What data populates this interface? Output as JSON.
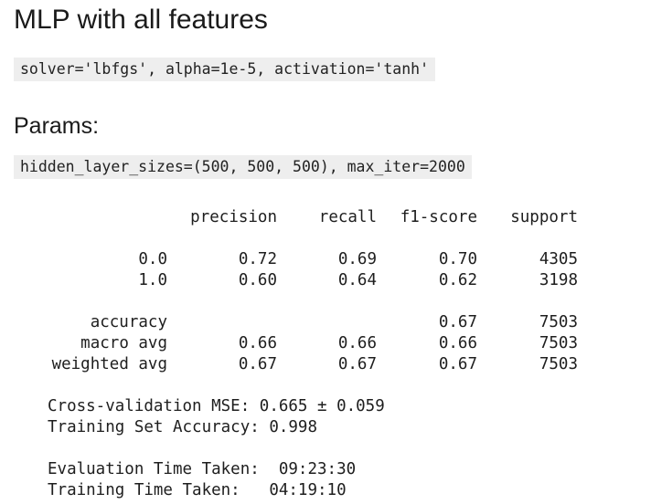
{
  "title": "MLP with all features",
  "solver_code": "solver='lbfgs', alpha=1e-5, activation='tanh'",
  "params_heading": "Params:",
  "hidden_code": "hidden_layer_sizes=(500, 500, 500), max_iter=2000",
  "report": {
    "headers": [
      "precision",
      "recall",
      "f1-score",
      "support"
    ],
    "rows": [
      {
        "label": "0.0",
        "precision": "0.72",
        "recall": "0.69",
        "f1": "0.70",
        "support": "4305"
      },
      {
        "label": "1.0",
        "precision": "0.60",
        "recall": "0.64",
        "f1": "0.62",
        "support": "3198"
      },
      {
        "label": "accuracy",
        "precision": "",
        "recall": "",
        "f1": "0.67",
        "support": "7503"
      },
      {
        "label": "macro avg",
        "precision": "0.66",
        "recall": "0.66",
        "f1": "0.66",
        "support": "7503"
      },
      {
        "label": "weighted avg",
        "precision": "0.67",
        "recall": "0.67",
        "f1": "0.67",
        "support": "7503"
      }
    ],
    "cv_line": "Cross-validation MSE: 0.665 ± 0.059",
    "train_acc_line": "Training Set Accuracy: 0.998",
    "eval_time_line": "Evaluation Time Taken:  09:23:30",
    "train_time_line": "Training Time Taken:   04:19:10"
  }
}
